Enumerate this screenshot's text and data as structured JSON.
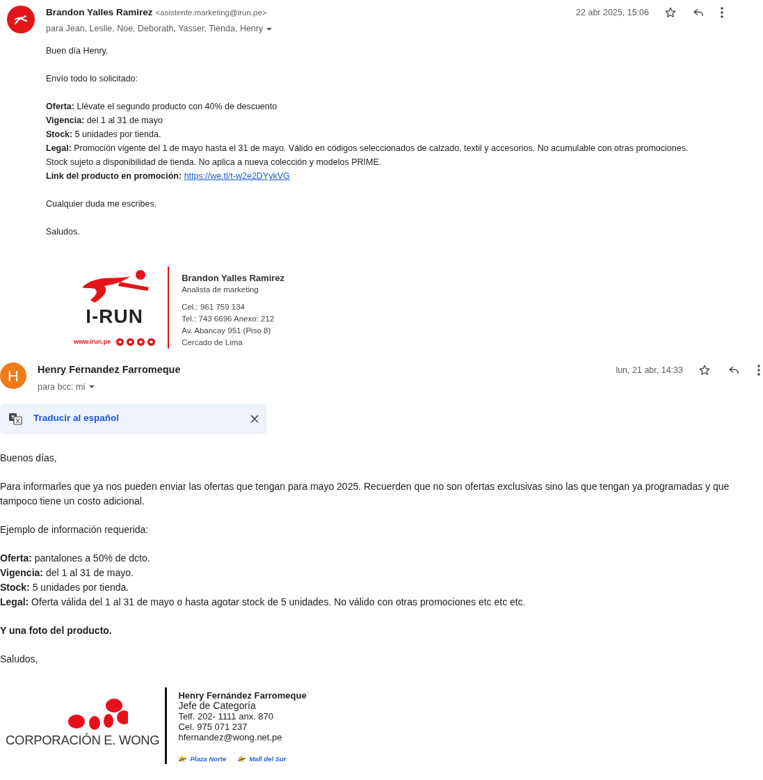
{
  "messages": [
    {
      "avatar": {
        "kind": "logo"
      },
      "sender": "Brandon Yalles Ramirez",
      "email": "<asistente.marketing@irun.pe>",
      "date": "22 abr 2025, 15:06",
      "starred": false,
      "recipients": "para Jean, Leslie, Noe, Deborath, Yasser, Tienda, Henry",
      "paragraphs": [
        [
          {
            "text": "Buen día Henry."
          }
        ],
        [
          {
            "text": "Envío todo lo solicitado:"
          }
        ],
        [
          {
            "text": "**Oferta:** Llévate el segundo producto con 40% de descuento"
          },
          {
            "text": "**Vigencia:** del 1 al 31 de mayo"
          },
          {
            "text": "**Stock:** 5 unidades por tienda."
          },
          {
            "text": "**Legal:** Promoción vigente del 1 de mayo hasta el 31 de mayo. Válido en códigos seleccionados de calzado, textil y accesorios. No acumulable con otras promociones."
          },
          {
            "text": "Stock sujeto a disponibilidad de tienda. No aplica a nueva colección y modelos PRIME."
          },
          {
            "text": "**Link del producto en promoción:**",
            "link": "https://we.tl/t-w2e2DYykVG"
          }
        ],
        [
          {
            "text": "Cualquier duda me escribes."
          }
        ],
        [
          {
            "text": "Saludos."
          }
        ]
      ],
      "signature": {
        "kind": "irun",
        "logo_text": "I-RUN",
        "website": "www.irun.pe",
        "name": "Brandon Yalles Ramirez",
        "title": "Analista de marketing",
        "lines": [
          "Cel.: 961 759 134",
          "Tel.: 743 6696 Anexo: 212",
          "Av. Abancay 951 (Piso 8)",
          "Cercado de Lima"
        ]
      }
    },
    {
      "avatar": {
        "kind": "letter",
        "text": "H"
      },
      "sender": "Henry Fernandez Farromeque",
      "date": "lun, 21 abr, 14:33",
      "starred": false,
      "recipients": "para bcc: mí",
      "translate": {
        "label": "Traducir al español"
      },
      "paragraphs": [
        [
          {
            "text": "Buenos días,"
          }
        ],
        [
          {
            "text": "Para informarles que ya nos pueden enviar las ofertas que tengan para mayo 2025. Recuerden que no son ofertas exclusivas sino las que tengan ya programadas y que"
          },
          {
            "text": "tampoco tiene un costo adicional."
          }
        ],
        [
          {
            "text": "Ejemplo de información requerida:"
          }
        ],
        [
          {
            "text": "**Oferta:** pantalones a 50% de dcto."
          },
          {
            "text": "**Vigencia:** del 1 al 31 de mayo."
          },
          {
            "text": "**Stock:** 5 unidades por tienda."
          },
          {
            "text": "**Legal:** Oferta válida del 1 al 31 de mayo o hasta agotar stock de 5 unidades. No válido con otras promociones etc etc etc."
          }
        ],
        [
          {
            "text": "**Y una foto del producto.**"
          }
        ],
        [
          {
            "text": "Saludos,"
          }
        ]
      ],
      "signature": {
        "kind": "wong",
        "logo_text": "CORPORACIÓN E. WONG",
        "name": "Henry Fernández Farromeque",
        "title": "Jefe de Categoría",
        "lines": [
          "Telf. 202- 1111 anx. 870",
          "Cel. 975 071 237",
          "hfernandez@wong.net.pe"
        ],
        "malls": [
          "Plaza Norte",
          "Mall del Sur"
        ]
      }
    }
  ]
}
